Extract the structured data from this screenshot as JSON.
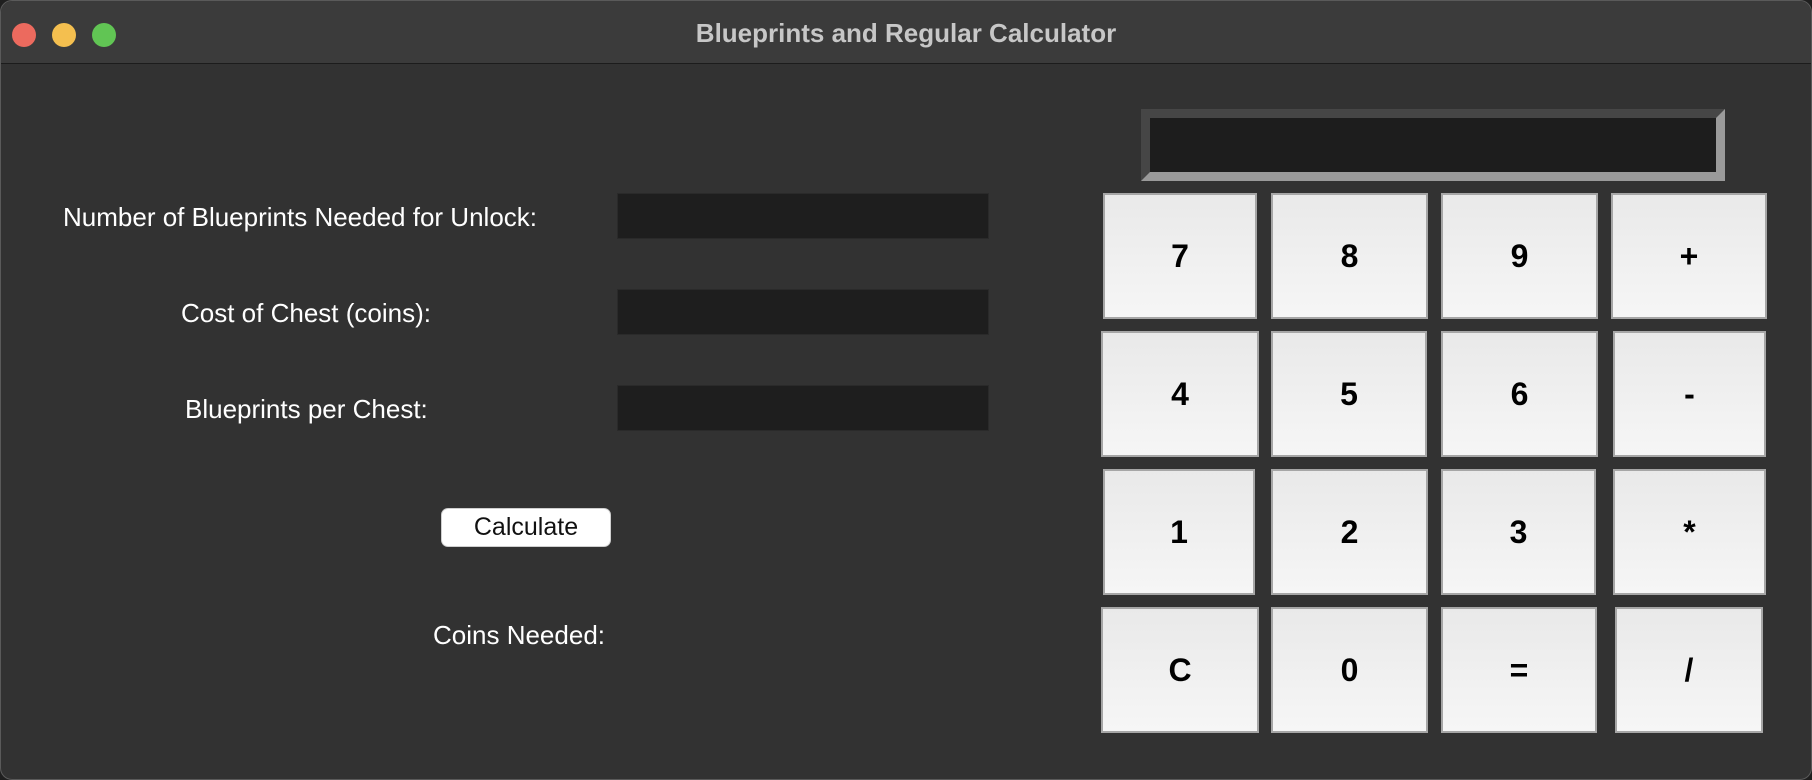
{
  "window": {
    "title": "Blueprints and Regular Calculator"
  },
  "form": {
    "blueprints_needed_label": "Number of Blueprints Needed for Unlock:",
    "blueprints_needed_value": "",
    "chest_cost_label": "Cost of Chest (coins):",
    "chest_cost_value": "",
    "blueprints_per_chest_label": "Blueprints per Chest:",
    "blueprints_per_chest_value": "",
    "calculate_label": "Calculate",
    "coins_needed_label": "Coins Needed:"
  },
  "calculator": {
    "display_value": "",
    "keys": {
      "k7": "7",
      "k8": "8",
      "k9": "9",
      "kplus": "+",
      "k4": "4",
      "k5": "5",
      "k6": "6",
      "kminus": "-",
      "k1": "1",
      "k2": "2",
      "k3": "3",
      "kmul": "*",
      "kclear": "C",
      "k0": "0",
      "keq": "=",
      "kdiv": "/"
    }
  },
  "colors": {
    "background": "#323232",
    "titlebar": "#3b3b3b",
    "input_background": "#1e1e1e",
    "key_face": "#efefef",
    "close": "#ec6a5e",
    "minimize": "#f4bf4f",
    "maximize": "#61c554"
  }
}
